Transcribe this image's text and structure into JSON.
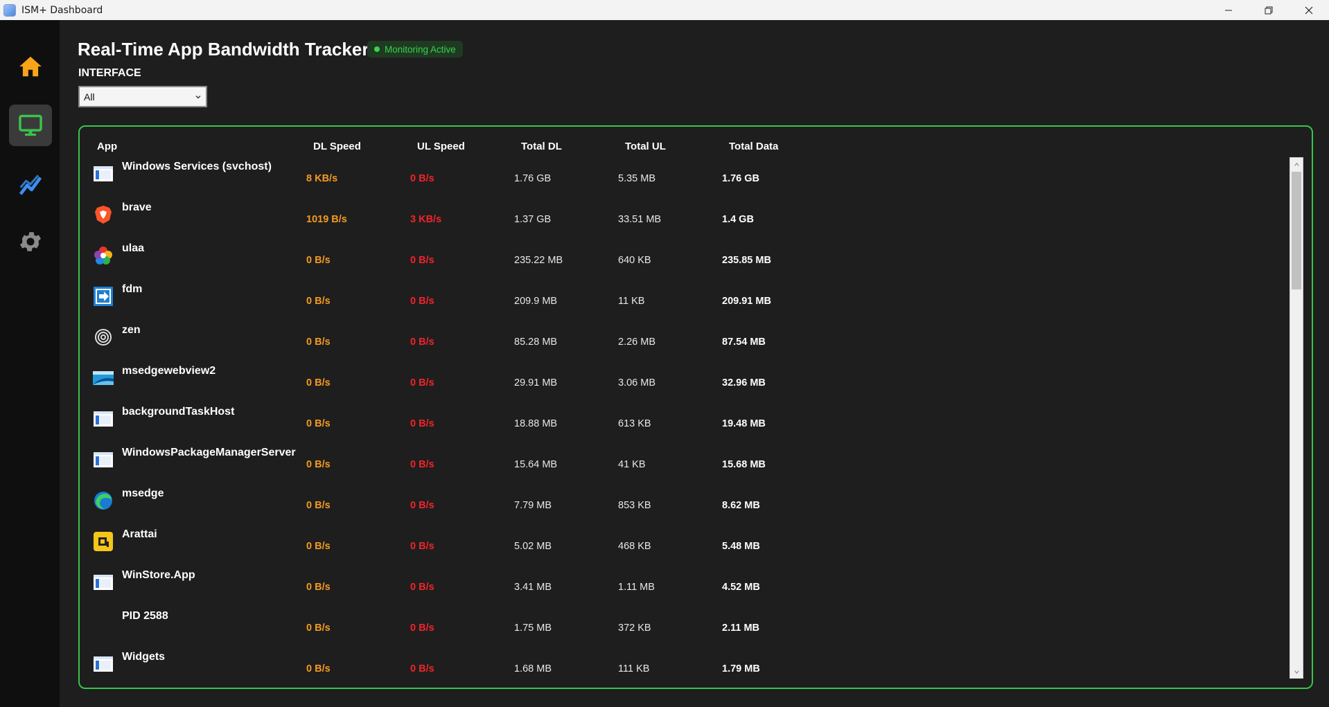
{
  "window": {
    "title": "ISM+ Dashboard"
  },
  "sidebar": {
    "items": [
      {
        "icon": "home-icon",
        "color": "#f7a418"
      },
      {
        "icon": "monitor-icon",
        "color": "#39c44a",
        "active": true
      },
      {
        "icon": "chart-icon",
        "color": "#3a8ef0"
      },
      {
        "icon": "gear-icon",
        "color": "#8a8a8a"
      }
    ]
  },
  "header": {
    "title": "Real-Time App Bandwidth Tracker",
    "status": "Monitoring Active",
    "interface_label": "INTERFACE",
    "interface_value": "All"
  },
  "table": {
    "columns": [
      "App",
      "DL Speed",
      "UL Speed",
      "Total DL",
      "Total UL",
      "Total Data"
    ],
    "rows": [
      {
        "app": "Windows Services (svchost)",
        "icon": "window-app-icon",
        "dl": "8 KB/s",
        "ul": "0 B/s",
        "total_dl": "1.76 GB",
        "total_ul": "5.35 MB",
        "total": "1.76 GB"
      },
      {
        "app": "brave",
        "icon": "brave-icon",
        "dl": "1019 B/s",
        "ul": "3 KB/s",
        "total_dl": "1.37 GB",
        "total_ul": "33.51 MB",
        "total": "1.4 GB"
      },
      {
        "app": "ulaa",
        "icon": "ulaa-icon",
        "dl": "0 B/s",
        "ul": "0 B/s",
        "total_dl": "235.22 MB",
        "total_ul": "640 KB",
        "total": "235.85 MB"
      },
      {
        "app": "fdm",
        "icon": "fdm-icon",
        "dl": "0 B/s",
        "ul": "0 B/s",
        "total_dl": "209.9 MB",
        "total_ul": "11 KB",
        "total": "209.91 MB"
      },
      {
        "app": "zen",
        "icon": "zen-icon",
        "dl": "0 B/s",
        "ul": "0 B/s",
        "total_dl": "85.28 MB",
        "total_ul": "2.26 MB",
        "total": "87.54 MB"
      },
      {
        "app": "msedgewebview2",
        "icon": "webview-icon",
        "dl": "0 B/s",
        "ul": "0 B/s",
        "total_dl": "29.91 MB",
        "total_ul": "3.06 MB",
        "total": "32.96 MB"
      },
      {
        "app": "backgroundTaskHost",
        "icon": "window-app-icon",
        "dl": "0 B/s",
        "ul": "0 B/s",
        "total_dl": "18.88 MB",
        "total_ul": "613 KB",
        "total": "19.48 MB"
      },
      {
        "app": "WindowsPackageManagerServer",
        "icon": "window-app-icon",
        "dl": "0 B/s",
        "ul": "0 B/s",
        "total_dl": "15.64 MB",
        "total_ul": "41 KB",
        "total": "15.68 MB"
      },
      {
        "app": "msedge",
        "icon": "edge-icon",
        "dl": "0 B/s",
        "ul": "0 B/s",
        "total_dl": "7.79 MB",
        "total_ul": "853 KB",
        "total": "8.62 MB"
      },
      {
        "app": "Arattai",
        "icon": "arattai-icon",
        "dl": "0 B/s",
        "ul": "0 B/s",
        "total_dl": "5.02 MB",
        "total_ul": "468 KB",
        "total": "5.48 MB"
      },
      {
        "app": "WinStore.App",
        "icon": "window-app-icon",
        "dl": "0 B/s",
        "ul": "0 B/s",
        "total_dl": "3.41 MB",
        "total_ul": "1.11 MB",
        "total": "4.52 MB"
      },
      {
        "app": "PID 2588",
        "icon": "none",
        "dl": "0 B/s",
        "ul": "0 B/s",
        "total_dl": "1.75 MB",
        "total_ul": "372 KB",
        "total": "2.11 MB"
      },
      {
        "app": "Widgets",
        "icon": "window-app-icon",
        "dl": "0 B/s",
        "ul": "0 B/s",
        "total_dl": "1.68 MB",
        "total_ul": "111 KB",
        "total": "1.79 MB"
      }
    ]
  },
  "colors": {
    "accent": "#39c44a",
    "dl_speed": "#f59a1e",
    "ul_speed": "#f2232a"
  }
}
